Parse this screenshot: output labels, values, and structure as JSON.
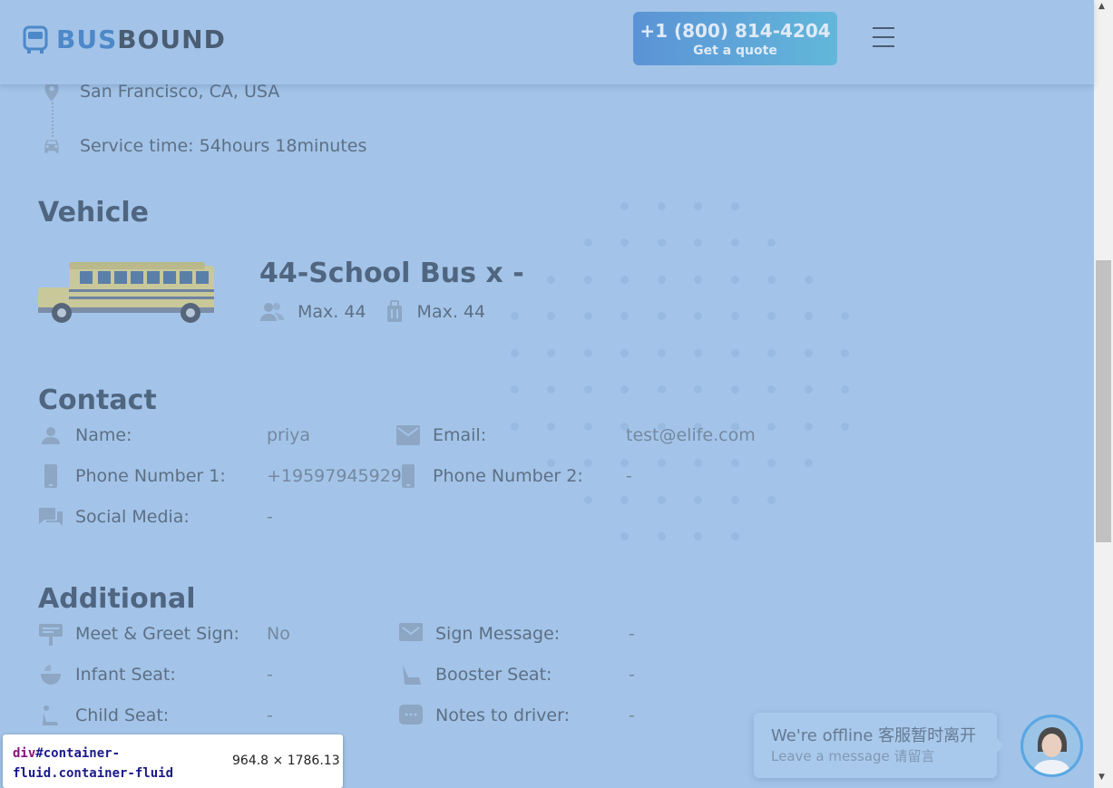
{
  "header": {
    "logo_part1": "BUS",
    "logo_part2": "BOUND",
    "phone": "+1 (800) 814-4204",
    "quote_label": "Get a quote"
  },
  "route": {
    "location": "San Francisco, CA, USA",
    "service_time": "Service time: 54hours 18minutes"
  },
  "vehicle": {
    "section_title": "Vehicle",
    "name": "44-School Bus x -",
    "passengers": "Max. 44",
    "luggage": "Max. 44"
  },
  "contact": {
    "section_title": "Contact",
    "name_label": "Name:",
    "name_value": "priya",
    "email_label": "Email:",
    "email_value": "test@elife.com",
    "phone1_label": "Phone Number 1:",
    "phone1_value": "+19597945929",
    "phone2_label": "Phone Number 2:",
    "phone2_value": "-",
    "social_label": "Social Media:",
    "social_value": "-"
  },
  "additional": {
    "section_title": "Additional",
    "meet_label": "Meet & Greet Sign:",
    "meet_value": "No",
    "sign_label": "Sign Message:",
    "sign_value": "-",
    "infant_label": "Infant Seat:",
    "infant_value": "-",
    "booster_label": "Booster Seat:",
    "booster_value": "-",
    "child_label": "Child Seat:",
    "child_value": "-",
    "notes_label": "Notes to driver:",
    "notes_value": "-"
  },
  "devtools_tip": {
    "tag": "div",
    "selector": "#container-fluid.container-fluid",
    "dimensions": "964.8 × 1786.13"
  },
  "chat": {
    "status": "We're offline 客服暂时离开",
    "prompt": "Leave a message 请留言"
  },
  "colors": {
    "overlay_bg": "#a3c4e8",
    "accent": "#4d88c9",
    "heading": "#4f6580"
  }
}
